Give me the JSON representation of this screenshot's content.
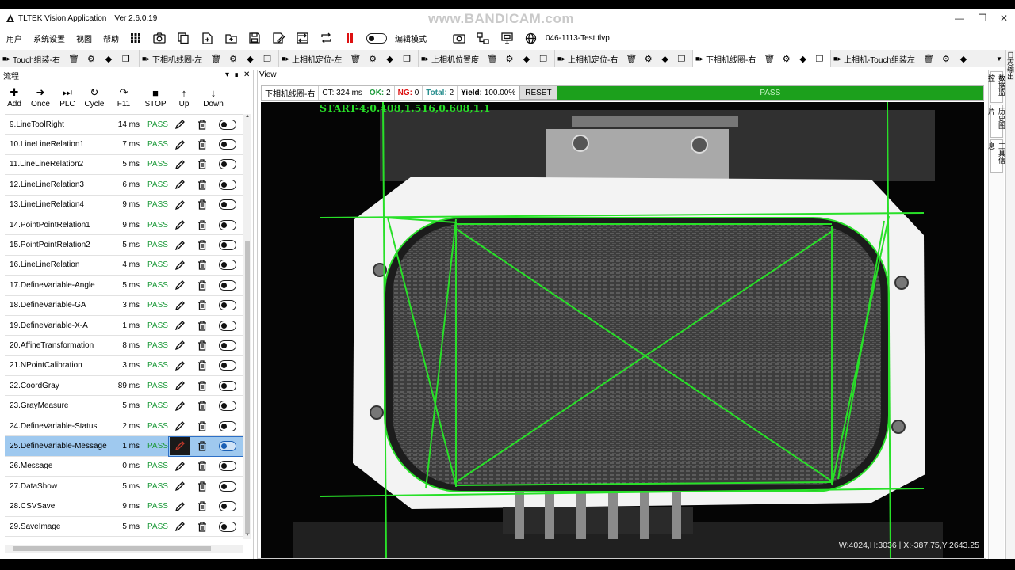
{
  "app": {
    "title": "TLTEK Vision Application",
    "version": "Ver 2.6.0.19",
    "watermark": "www.BANDICAM.com"
  },
  "menu": {
    "items": [
      "用户",
      "系统设置",
      "视图",
      "帮助"
    ],
    "edit_mode_label": "编辑模式",
    "project_file": "046-1113-Test.tlvp"
  },
  "tabs": [
    {
      "label": "Touch组装-右",
      "active": false
    },
    {
      "label": "下相机线圈-左",
      "active": false
    },
    {
      "label": "上相机定位-左",
      "active": false
    },
    {
      "label": "上相机位置度",
      "active": false
    },
    {
      "label": "上相机定位-右",
      "active": false
    },
    {
      "label": "下相机线圈-右",
      "active": true
    },
    {
      "label": "上相机-Touch组装左",
      "active": false
    }
  ],
  "right_strip": {
    "label": "日志输出"
  },
  "side_panel": {
    "items": [
      "数据监控",
      "历史图片",
      "工具信息"
    ]
  },
  "flow_panel": {
    "title": "流程",
    "tools": [
      "Add",
      "Once",
      "PLC",
      "Cycle",
      "F11",
      "STOP",
      "Up",
      "Down"
    ],
    "steps": [
      {
        "name": "9.LineToolRight",
        "time": "14 ms",
        "status": "PASS",
        "selected": false
      },
      {
        "name": "10.LineLineRelation1",
        "time": "7 ms",
        "status": "PASS",
        "selected": false
      },
      {
        "name": "11.LineLineRelation2",
        "time": "5 ms",
        "status": "PASS",
        "selected": false
      },
      {
        "name": "12.LineLineRelation3",
        "time": "6 ms",
        "status": "PASS",
        "selected": false
      },
      {
        "name": "13.LineLineRelation4",
        "time": "9 ms",
        "status": "PASS",
        "selected": false
      },
      {
        "name": "14.PointPointRelation1",
        "time": "9 ms",
        "status": "PASS",
        "selected": false
      },
      {
        "name": "15.PointPointRelation2",
        "time": "5 ms",
        "status": "PASS",
        "selected": false
      },
      {
        "name": "16.LineLineRelation",
        "time": "4 ms",
        "status": "PASS",
        "selected": false
      },
      {
        "name": "17.DefineVariable-Angle",
        "time": "5 ms",
        "status": "PASS",
        "selected": false
      },
      {
        "name": "18.DefineVariable-GA",
        "time": "3 ms",
        "status": "PASS",
        "selected": false
      },
      {
        "name": "19.DefineVariable-X-A",
        "time": "1 ms",
        "status": "PASS",
        "selected": false
      },
      {
        "name": "20.AffineTransformation",
        "time": "8 ms",
        "status": "PASS",
        "selected": false
      },
      {
        "name": "21.NPointCalibration",
        "time": "3 ms",
        "status": "PASS",
        "selected": false
      },
      {
        "name": "22.CoordGray",
        "time": "89 ms",
        "status": "PASS",
        "selected": false
      },
      {
        "name": "23.GrayMeasure",
        "time": "5 ms",
        "status": "PASS",
        "selected": false
      },
      {
        "name": "24.DefineVariable-Status",
        "time": "2 ms",
        "status": "PASS",
        "selected": false
      },
      {
        "name": "25.DefineVariable-Message",
        "time": "1 ms",
        "status": "PASS",
        "selected": true
      },
      {
        "name": "26.Message",
        "time": "0 ms",
        "status": "PASS",
        "selected": false
      },
      {
        "name": "27.DataShow",
        "time": "5 ms",
        "status": "PASS",
        "selected": false
      },
      {
        "name": "28.CSVSave",
        "time": "9 ms",
        "status": "PASS",
        "selected": false
      },
      {
        "name": "29.SaveImage",
        "time": "5 ms",
        "status": "PASS",
        "selected": false
      }
    ]
  },
  "view": {
    "label": "View",
    "camera_name": "下相机线圈-右",
    "ct": "CT: 324 ms",
    "ok_label": "OK:",
    "ok_value": "2",
    "ng_label": "NG:",
    "ng_value": "0",
    "total_label": "Total:",
    "total_value": "2",
    "yield_label": "Yield:",
    "yield_value": "100.00%",
    "reset_label": "RESET",
    "result": "PASS",
    "overlay_text": "START-4;0.408,1.516,0.608,1,1",
    "readout": "W:4024,H:3036 | X:-387.75,Y:2643.25"
  },
  "colors": {
    "pass_green": "#1d9a3a",
    "result_bar": "#1ca01c",
    "overlay_green": "#28e028",
    "ng_red": "#dd1111",
    "selection": "#9fc9ef"
  }
}
